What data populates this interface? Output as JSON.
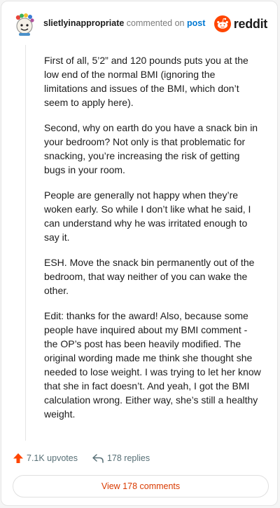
{
  "header": {
    "username": "slietlyinappropriate",
    "verb": "commented on",
    "post_link": "post",
    "brand": "reddit"
  },
  "comment": {
    "paragraphs": [
      "First of all, 5’2” and 120 pounds puts you at the low end of the normal BMI (ignoring the limitations and issues of the BMI, which don’t seem to apply here).",
      "Second, why on earth do you have a snack bin in your bedroom? Not only is that problematic for snacking, you’re increasing the risk of getting bugs in your room.",
      "People are generally not happy when they’re woken early. So while I don’t like what he said, I can understand why he was irritated enough to say it.",
      "ESH. Move the snack bin permanently out of the bedroom, that way neither of you can wake the other.",
      "Edit: thanks for the award! Also, because some people have inquired about my BMI comment - the OP’s post has been heavily modified. The original wording made me think she thought she needed to lose weight. I was trying to let her know that she in fact doesn’t. And yeah, I got the BMI calculation wrong. Either way, she’s still a healthy weight."
    ]
  },
  "actions": {
    "upvotes": "7.1K upvotes",
    "replies": "178 replies"
  },
  "view_comments": "View 178 comments",
  "colors": {
    "accent": "#ff4500",
    "link": "#0079d3",
    "view_text": "#d93a00"
  }
}
